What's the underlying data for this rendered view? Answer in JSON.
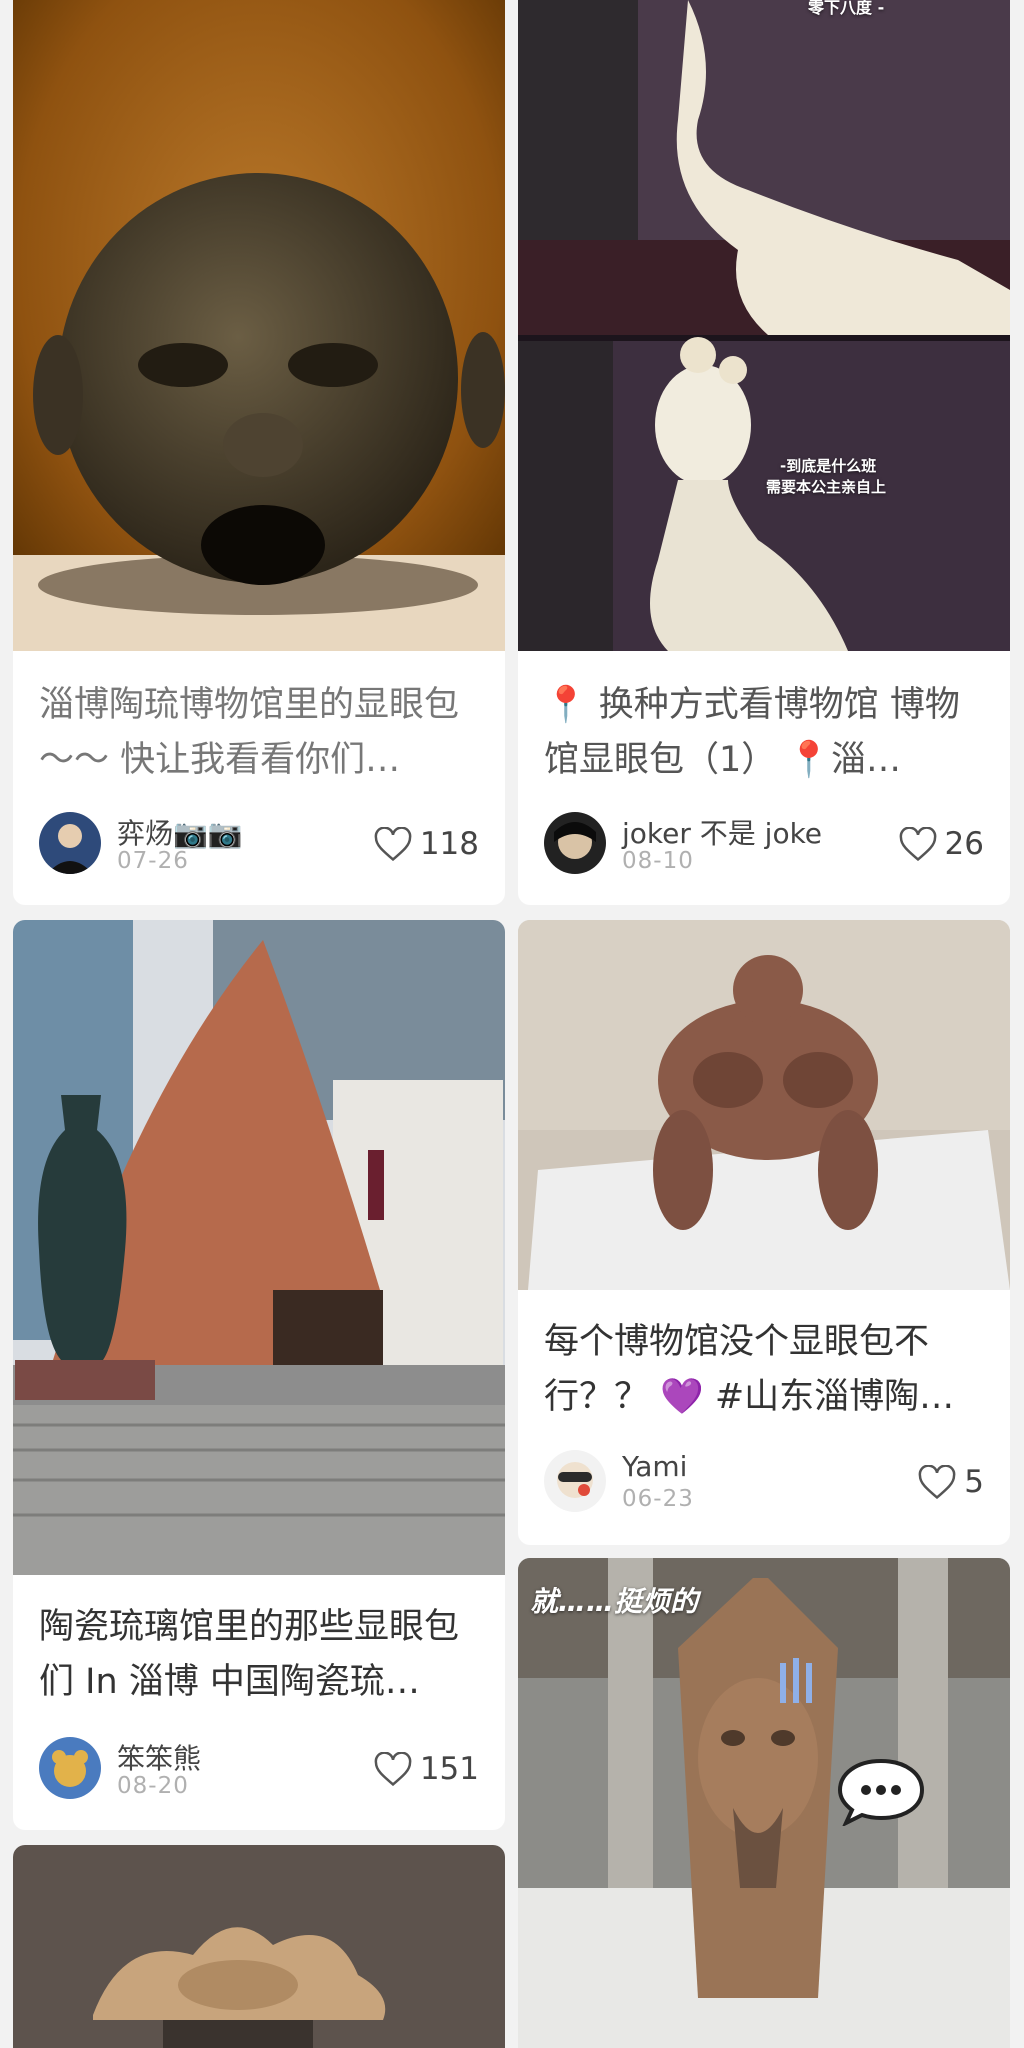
{
  "cards": [
    {
      "title": "淄博陶琉博物馆里的显眼包～～ 快让我看看你们…",
      "author": "弈炀📷📷",
      "date": "07-26",
      "likes": "118"
    },
    {
      "title": "📍 换种方式看博物馆 博物馆显眼包（1） 📍淄…",
      "author": "joker 不是 joke",
      "date": "08-10",
      "likes": "26",
      "overlay_top": "零下八度 -",
      "overlay_line1": "-到底是什么班",
      "overlay_line2": "需要本公主亲自上"
    },
    {
      "title": "陶瓷琉璃馆里的那些显眼包们 In 淄博 中国陶瓷琉…",
      "author": "笨笨熊",
      "date": "08-20",
      "likes": "151"
    },
    {
      "title": "每个博物馆没个显眼包不行？？ 💜 #山东淄博陶…",
      "author": "Yami",
      "date": "06-23",
      "likes": "5"
    },
    {
      "overlay_text": "就……挺烦的"
    }
  ],
  "icons": {
    "like": "heart-outline-icon",
    "bubble": "speech-bubble-icon"
  },
  "colors": {
    "background": "#f2f2f2",
    "card": "#ffffff",
    "text": "#333333",
    "muted": "#b0b0b0"
  }
}
